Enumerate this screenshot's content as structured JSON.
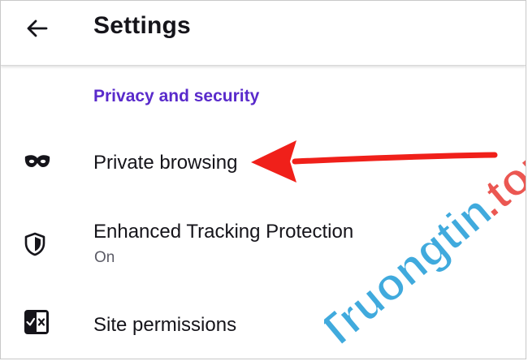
{
  "header": {
    "title": "Settings",
    "back_icon": "arrow-left-icon"
  },
  "section": {
    "title": "Privacy and security",
    "color": "#592acb"
  },
  "items": [
    {
      "label": "Private browsing",
      "icon": "mask-icon"
    },
    {
      "label": "Enhanced Tracking Protection",
      "sublabel": "On",
      "icon": "shield-icon"
    },
    {
      "label": "Site permissions",
      "icon": "site-permissions-icon"
    }
  ],
  "annotation": {
    "arrow_color": "#f0201a"
  },
  "watermark": {
    "text": "Truongtin.top",
    "logo": "Truongtin",
    "tld": ".top",
    "logo_color": "#1e9bd7",
    "tld_color": "#e83a34"
  }
}
